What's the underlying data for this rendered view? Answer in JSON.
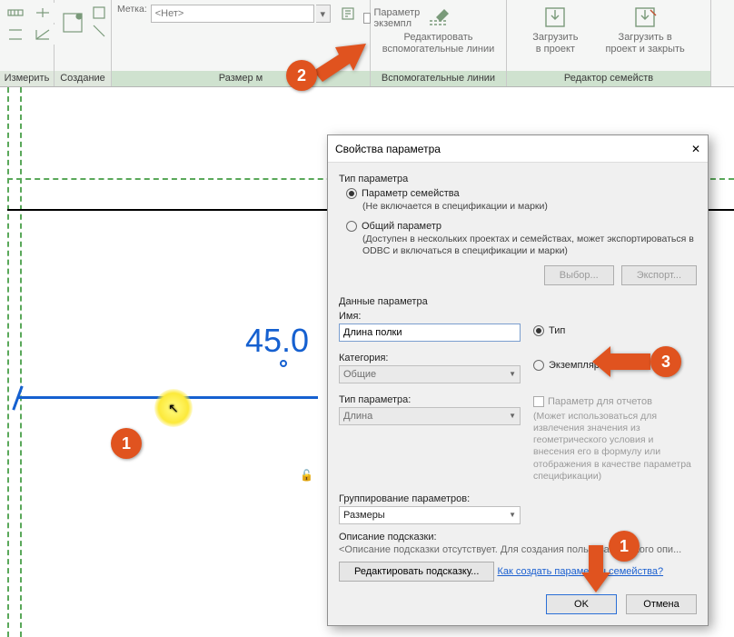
{
  "ribbon": {
    "panels": {
      "measure": "Измерить",
      "create": "Создание",
      "dimM": "Размер м",
      "reflines": "Вспомогательные линии",
      "editor": "Редактор семейств"
    },
    "dim": {
      "metka_label": "Метка:",
      "metka_value": "<Нет>",
      "instance_param": "Параметр экземпл"
    },
    "btnRef": {
      "l1": "Редактировать",
      "l2": "вспомогательные линии"
    },
    "btnLoad": {
      "l1": "Загрузить",
      "l2": "в проект"
    },
    "btnLoadC": {
      "l1": "Загрузить в",
      "l2": "проект и закрыть"
    }
  },
  "canvas": {
    "dim_value": "45.0"
  },
  "callouts": {
    "c1": "1",
    "c2": "2",
    "c3": "3",
    "c4": "1"
  },
  "dialog": {
    "title": "Свойства параметра",
    "paramtype": {
      "label": "Тип параметра",
      "family": "Параметр семейства",
      "family_hint": "(Не включается в спецификации и марки)",
      "shared": "Общий параметр",
      "shared_hint": "(Доступен в нескольких проектах и семействах, может экспортироваться в ODBC и включаться в спецификации и марки)",
      "select": "Выбор...",
      "export": "Экспорт..."
    },
    "data": {
      "section": "Данные параметра",
      "name_lbl": "Имя:",
      "name_val": "Длина полки",
      "type_radio": "Тип",
      "inst_radio": "Экземпляр",
      "cat_lbl": "Категория:",
      "cat_val": "Общие",
      "ptype_lbl": "Тип параметра:",
      "ptype_val": "Длина",
      "group_lbl": "Группирование параметров:",
      "group_val": "Размеры",
      "report_chk": "Параметр для отчетов",
      "report_note": "(Может использоваться для извлечения значения из геометрического условия и внесения его в формулу или отображения в качестве параметра спецификации)",
      "tip_lbl": "Описание подсказки:",
      "tip_txt": "<Описание подсказки отсутствует. Для создания пользовательского опи...",
      "tip_btn": "Редактировать подсказку...",
      "link": "Как создать параметры семейства?"
    },
    "ok": "OK",
    "cancel": "Отмена"
  }
}
